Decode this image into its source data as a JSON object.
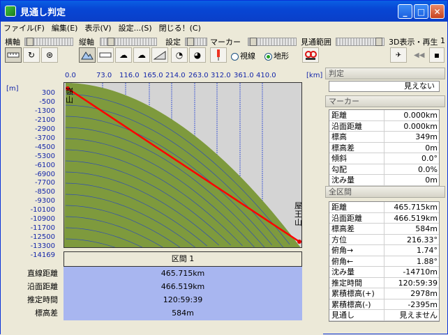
{
  "window": {
    "title": "見通し判定"
  },
  "menu": [
    "ファイル(F)",
    "編集(E)",
    "表示(V)",
    "設定...(S)",
    "閉じる！(C)"
  ],
  "toolbar": {
    "horizontal_label": "横軸",
    "vertical_label": "縦軸",
    "settings_label": "設定",
    "marker_label": "マーカー",
    "view_range_label": "見通範囲",
    "display_3d_label": "3D表示・再生",
    "display_3d_value": "1",
    "radio_sight": "視線",
    "radio_terrain": "地形",
    "radio_selected": "地形"
  },
  "chart_labels": {
    "x_unit": "[km]",
    "y_unit": "[m]",
    "start_name": "嶺山",
    "end_name": "屋王山"
  },
  "chart_data": {
    "type": "area",
    "xlabel": "[km]",
    "ylabel": "[m]",
    "x_ticks": [
      "0.0",
      "73.0",
      "116.0",
      "165.0",
      "214.0",
      "263.0",
      "312.0",
      "361.0",
      "410.0"
    ],
    "y_ticks": [
      "300",
      "-500",
      "-1300",
      "-2100",
      "-2900",
      "-3700",
      "-4500",
      "-5300",
      "-6100",
      "-6900",
      "-7700",
      "-8500",
      "-9300",
      "-10100",
      "-10900",
      "-11700",
      "-12500",
      "-13300",
      "-14169"
    ],
    "xlim": [
      0,
      465.715
    ],
    "ylim": [
      -14169,
      300
    ],
    "series": [
      {
        "type": "line",
        "color": "#ff0000",
        "x": [
          0,
          465.715
        ],
        "y": [
          349,
          584
        ]
      }
    ],
    "colors": {
      "terrain": "#7e9a3d",
      "sky": "#d4d4d4",
      "sight_line": "#ff0000",
      "contour": "#1d3bd2"
    }
  },
  "section": {
    "title": "区間 1",
    "labels": [
      "直線距離",
      "沿面距離",
      "推定時間",
      "標高差"
    ],
    "values": [
      "465.715km",
      "466.519km",
      "120:59:39",
      "584m"
    ]
  },
  "right_panel": {
    "judgement_head": "判定",
    "judgement_value": "見えない",
    "marker_head": "マーカー",
    "marker_rows": [
      {
        "k": "距離",
        "v": "0.000km"
      },
      {
        "k": "沿面距離",
        "v": "0.000km"
      },
      {
        "k": "標高",
        "v": "349m"
      },
      {
        "k": "標高差",
        "v": "0m"
      },
      {
        "k": "傾斜",
        "v": "0.0°"
      },
      {
        "k": "勾配",
        "v": "0.0%"
      },
      {
        "k": "沈み量",
        "v": "0m"
      }
    ],
    "all_head": "全区間",
    "all_rows": [
      {
        "k": "距離",
        "v": "465.715km"
      },
      {
        "k": "沿面距離",
        "v": "466.519km"
      },
      {
        "k": "標高差",
        "v": "584m"
      },
      {
        "k": "方位",
        "v": "216.33°"
      },
      {
        "k": "俯角→",
        "v": "1.74°"
      },
      {
        "k": "俯角←",
        "v": "1.88°"
      },
      {
        "k": "沈み量",
        "v": "-14710m"
      },
      {
        "k": "推定時間",
        "v": "120:59:39"
      },
      {
        "k": "累積標高(+)",
        "v": "2978m"
      },
      {
        "k": "累積標高(-)",
        "v": "-2395m"
      },
      {
        "k": "見通し",
        "v": "見えません"
      }
    ]
  }
}
